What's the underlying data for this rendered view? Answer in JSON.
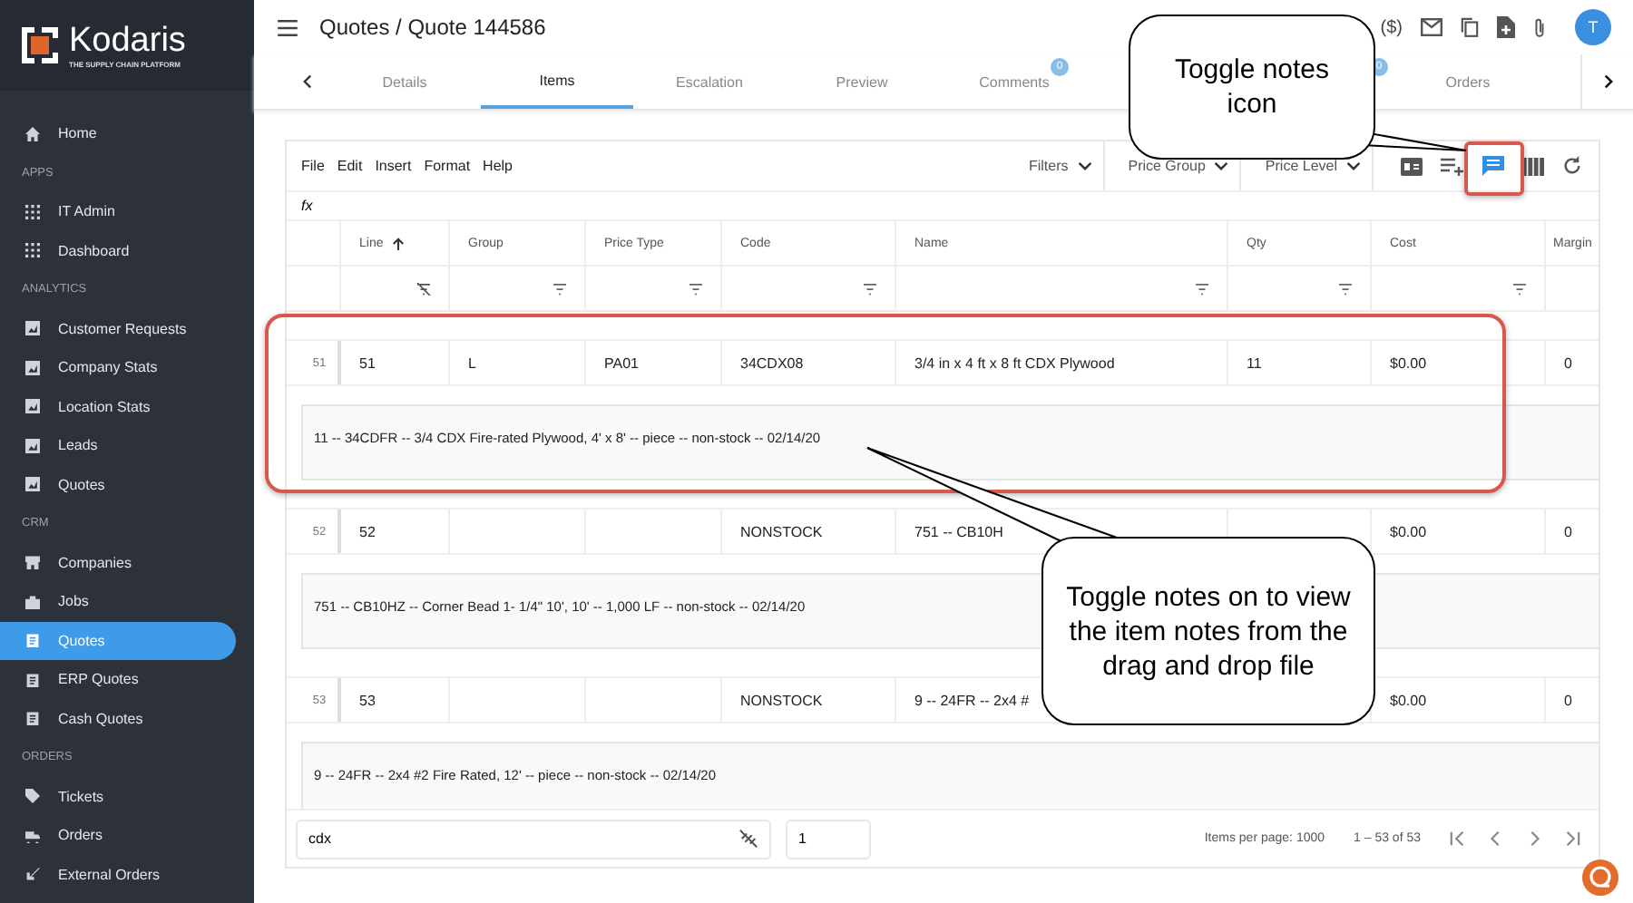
{
  "sidebar": {
    "brand": "Kodaris",
    "tagline": "THE SUPPLY CHAIN PLATFORM",
    "items": [
      {
        "kind": "item",
        "label": "Home",
        "selected": false
      },
      {
        "kind": "section",
        "label": "APPS"
      },
      {
        "kind": "item",
        "label": "IT Admin",
        "selected": false
      },
      {
        "kind": "item",
        "label": "Dashboard",
        "selected": false
      },
      {
        "kind": "section",
        "label": "ANALYTICS"
      },
      {
        "kind": "item",
        "label": "Customer Requests",
        "selected": false
      },
      {
        "kind": "item",
        "label": "Company Stats",
        "selected": false
      },
      {
        "kind": "item",
        "label": "Location Stats",
        "selected": false
      },
      {
        "kind": "item",
        "label": "Leads",
        "selected": false
      },
      {
        "kind": "item",
        "label": "Quotes",
        "selected": false
      },
      {
        "kind": "section",
        "label": "CRM"
      },
      {
        "kind": "item",
        "label": "Companies",
        "selected": false
      },
      {
        "kind": "item",
        "label": "Jobs",
        "selected": false
      },
      {
        "kind": "item",
        "label": "Quotes",
        "selected": true
      },
      {
        "kind": "item",
        "label": "ERP Quotes",
        "selected": false
      },
      {
        "kind": "item",
        "label": "Cash Quotes",
        "selected": false
      },
      {
        "kind": "section",
        "label": "ORDERS"
      },
      {
        "kind": "item",
        "label": "Tickets",
        "selected": false
      },
      {
        "kind": "item",
        "label": "Orders",
        "selected": false
      },
      {
        "kind": "item",
        "label": "External Orders",
        "selected": false
      }
    ]
  },
  "header": {
    "title": "Quotes / Quote 144586",
    "currency": "($)",
    "avatar": "T"
  },
  "tabs": [
    {
      "label": "Details",
      "selected": false
    },
    {
      "label": "Items",
      "selected": true
    },
    {
      "label": "Escalation",
      "selected": false
    },
    {
      "label": "Preview",
      "selected": false
    },
    {
      "label": "Comments",
      "badge": "0",
      "selected": false
    },
    {
      "badge": "0",
      "selected": false
    },
    {
      "label": "Orders",
      "selected": false
    }
  ],
  "toolbar": {
    "menus": [
      "File",
      "Edit",
      "Insert",
      "Format",
      "Help"
    ],
    "dropdowns": [
      "Filters",
      "Price Group",
      "Price Level"
    ],
    "notes_on": true
  },
  "formula_bar": {
    "label": "fx"
  },
  "table": {
    "columns": [
      "Line",
      "Group",
      "Price Type",
      "Code",
      "Name",
      "Qty",
      "Cost",
      "Margin"
    ],
    "rows": [
      {
        "number": "51",
        "cells": [
          "51",
          "L",
          "PA01",
          "34CDX08",
          "3/4 in x 4 ft x 8 ft CDX Plywood",
          "11",
          "$0.00",
          "0"
        ],
        "note": "11 -- 34CDFR -- 3/4 CDX Fire-rated Plywood, 4' x 8' -- piece -- non-stock -- 02/14/20"
      },
      {
        "number": "52",
        "cells": [
          "52",
          "",
          "",
          "NONSTOCK",
          "751 -- CB10H",
          "",
          "$0.00",
          "0"
        ],
        "note": "751 -- CB10HZ -- Corner Bead 1- 1/4\" 10', 10' -- 1,000 LF -- non-stock -- 02/14/20"
      },
      {
        "number": "53",
        "cells": [
          "53",
          "",
          "",
          "NONSTOCK",
          "9 -- 24FR -- 2x4 #",
          "",
          "$0.00",
          "0"
        ],
        "note": "9 -- 24FR -- 2x4 #2 Fire Rated, 12' -- piece -- non-stock -- 02/14/20"
      }
    ]
  },
  "footer": {
    "search": "cdx",
    "page": "1",
    "per_page": "Items per page: 1000",
    "range": "1 – 53 of 53"
  },
  "callouts": [
    {
      "text": "Toggle notes icon"
    },
    {
      "text": "Toggle notes on to view the item notes from the drag and drop file"
    }
  ]
}
